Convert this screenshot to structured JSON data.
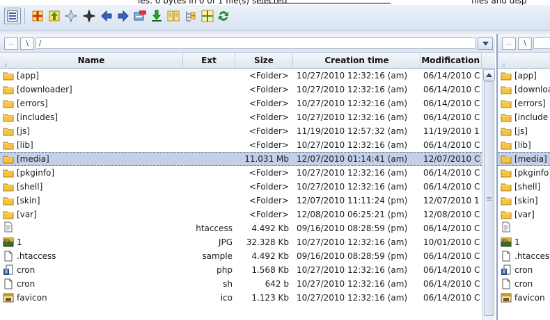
{
  "top_partial": {
    "left": "ies: 0 bytes in 0 of 1 file(s) selected",
    "right": "files and disp"
  },
  "toolbar": {
    "buttons": [
      {
        "name": "view-mode-icon"
      },
      {
        "name": "split-red-icon"
      },
      {
        "name": "split-green-icon"
      },
      {
        "name": "star-white-icon"
      },
      {
        "name": "star-dark-icon"
      },
      {
        "name": "arrow-left-icon"
      },
      {
        "name": "arrow-right-icon"
      },
      {
        "name": "ftp-icon"
      },
      {
        "name": "download-icon"
      },
      {
        "name": "compare-icon"
      },
      {
        "name": "tree-icon"
      },
      {
        "name": "sync-dirs-icon"
      },
      {
        "name": "refresh-icon"
      }
    ]
  },
  "left_panel": {
    "path": {
      "root_btn": "..",
      "sep_btn": "\\",
      "current": "/"
    },
    "columns": {
      "name": "Name",
      "ext": "Ext",
      "size": "Size",
      "created": "Creation time",
      "modified": "Modification"
    },
    "files": [
      {
        "icon": "folder",
        "name": "[app]",
        "ext": "",
        "size": "<Folder>",
        "created": "10/27/2010 12:32:16 (am)",
        "modified": "06/14/2010 C"
      },
      {
        "icon": "folder",
        "name": "[downloader]",
        "ext": "",
        "size": "<Folder>",
        "created": "10/27/2010 12:32:16 (am)",
        "modified": "06/14/2010 C"
      },
      {
        "icon": "folder",
        "name": "[errors]",
        "ext": "",
        "size": "<Folder>",
        "created": "10/27/2010 12:32:16 (am)",
        "modified": "06/14/2010 C"
      },
      {
        "icon": "folder",
        "name": "[includes]",
        "ext": "",
        "size": "<Folder>",
        "created": "10/27/2010 12:32:16 (am)",
        "modified": "06/14/2010 C"
      },
      {
        "icon": "folder",
        "name": "[js]",
        "ext": "",
        "size": "<Folder>",
        "created": "11/19/2010 12:57:32 (am)",
        "modified": "11/19/2010 1"
      },
      {
        "icon": "folder",
        "name": "[lib]",
        "ext": "",
        "size": "<Folder>",
        "created": "10/27/2010 12:32:16 (am)",
        "modified": "06/14/2010 C"
      },
      {
        "icon": "folder",
        "name": "[media]",
        "ext": "",
        "size": "11.031 Mb",
        "created": "12/07/2010 01:14:41 (am)",
        "modified": "12/07/2010 C",
        "selected": true
      },
      {
        "icon": "folder",
        "name": "[pkginfo]",
        "ext": "",
        "size": "<Folder>",
        "created": "10/27/2010 12:32:16 (am)",
        "modified": "06/14/2010 C"
      },
      {
        "icon": "folder",
        "name": "[shell]",
        "ext": "",
        "size": "<Folder>",
        "created": "10/27/2010 12:32:16 (am)",
        "modified": "06/14/2010 C"
      },
      {
        "icon": "folder",
        "name": "[skin]",
        "ext": "",
        "size": "<Folder>",
        "created": "12/07/2010 11:11:24 (pm)",
        "modified": "12/07/2010 1"
      },
      {
        "icon": "folder",
        "name": "[var]",
        "ext": "",
        "size": "<Folder>",
        "created": "12/08/2010 06:25:21 (pm)",
        "modified": "12/08/2010 C"
      },
      {
        "icon": "textfile",
        "name": "",
        "ext": "htaccess",
        "size": "4.492 Kb",
        "created": "09/16/2010 08:28:59 (pm)",
        "modified": "06/14/2010 C"
      },
      {
        "icon": "jpg",
        "name": "1",
        "ext": "JPG",
        "size": "32.328 Kb",
        "created": "10/27/2010 12:32:16 (am)",
        "modified": "10/01/2010 C"
      },
      {
        "icon": "blank",
        "name": ".htaccess",
        "ext": "sample",
        "size": "4.492 Kb",
        "created": "09/16/2010 08:28:59 (pm)",
        "modified": "06/14/2010 C"
      },
      {
        "icon": "php",
        "name": "cron",
        "ext": "php",
        "size": "1.568 Kb",
        "created": "10/27/2010 12:32:16 (am)",
        "modified": "06/14/2010 C"
      },
      {
        "icon": "blank",
        "name": "cron",
        "ext": "sh",
        "size": "642 b",
        "created": "10/27/2010 12:32:16 (am)",
        "modified": "06/14/2010 C"
      },
      {
        "icon": "ico",
        "name": "favicon",
        "ext": "ico",
        "size": "1.123 Kb",
        "created": "10/27/2010 12:32:16 (am)",
        "modified": "06/14/2010 C"
      }
    ]
  },
  "right_panel": {
    "path": {
      "root_btn": "..",
      "sep_btn": "\\"
    },
    "files": [
      {
        "icon": "folder",
        "name": "[app]"
      },
      {
        "icon": "folder",
        "name": "[downloa"
      },
      {
        "icon": "folder",
        "name": "[errors]"
      },
      {
        "icon": "folder",
        "name": "[include"
      },
      {
        "icon": "folder",
        "name": "[js]"
      },
      {
        "icon": "folder",
        "name": "[lib]"
      },
      {
        "icon": "folder",
        "name": "[media]"
      },
      {
        "icon": "folder",
        "name": "[pkginfo]"
      },
      {
        "icon": "folder",
        "name": "[shell]"
      },
      {
        "icon": "folder",
        "name": "[skin]"
      },
      {
        "icon": "folder",
        "name": "[var]"
      },
      {
        "icon": "textfile",
        "name": ""
      },
      {
        "icon": "jpg",
        "name": "1"
      },
      {
        "icon": "blank",
        "name": ".htacces"
      },
      {
        "icon": "php",
        "name": "cron"
      },
      {
        "icon": "blank",
        "name": "cron"
      },
      {
        "icon": "ico",
        "name": "favicon"
      }
    ]
  },
  "colors": {
    "selection": "#c3d0e8",
    "toolbar_bg": "#dfe7f3",
    "folder": "#f5c542"
  }
}
